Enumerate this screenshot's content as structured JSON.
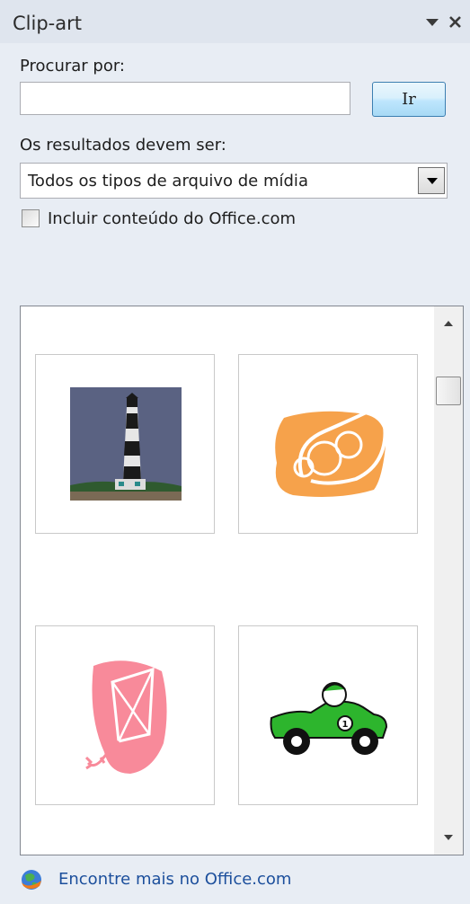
{
  "pane": {
    "title": "Clip-art",
    "menu_icon": "dropdown-arrow-icon",
    "close_icon": "close-icon"
  },
  "search": {
    "label": "Procurar por:",
    "value": "",
    "placeholder": "",
    "go_label": "Ir"
  },
  "results_filter": {
    "label": "Os resultados devem ser:",
    "selected": "Todos os tipos de arquivo de mídia"
  },
  "office_content": {
    "label": "Incluir conteúdo do Office.com",
    "checked": false
  },
  "results": {
    "items": [
      {
        "icon": "lighthouse-clipart"
      },
      {
        "icon": "cornucopia-clipart"
      },
      {
        "icon": "kite-clipart"
      },
      {
        "icon": "race-car-clipart"
      }
    ]
  },
  "footer": {
    "link_label": "Encontre mais no Office.com",
    "link_icon": "office-globe-icon"
  },
  "colors": {
    "pane_background": "#e8edf4",
    "link": "#1c4f9c",
    "cornucopia": "#f6a24b",
    "kite": "#f88a9a",
    "car": "#2db52d"
  }
}
